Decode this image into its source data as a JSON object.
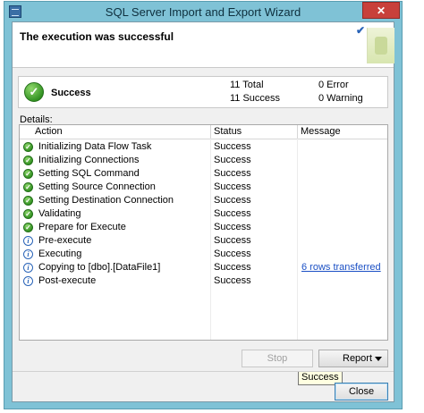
{
  "window": {
    "title": "SQL Server Import and Export Wizard",
    "close_glyph": "✕",
    "accent_color": "#7fc2d6"
  },
  "header": {
    "title": "The execution was successful",
    "check_glyph": "✔"
  },
  "summary": {
    "status_label": "Success",
    "total": "11 Total",
    "success": "11 Success",
    "error": "0  Error",
    "warning": "0  Warning"
  },
  "details": {
    "label": "Details:",
    "columns": [
      "Action",
      "Status",
      "Message"
    ],
    "rows": [
      {
        "icon": "success-check-icon",
        "action": "Initializing Data Flow Task",
        "status": "Success",
        "message": ""
      },
      {
        "icon": "success-check-icon",
        "action": "Initializing Connections",
        "status": "Success",
        "message": ""
      },
      {
        "icon": "success-check-icon",
        "action": "Setting SQL Command",
        "status": "Success",
        "message": ""
      },
      {
        "icon": "success-check-icon",
        "action": "Setting Source Connection",
        "status": "Success",
        "message": ""
      },
      {
        "icon": "success-check-icon",
        "action": "Setting Destination Connection",
        "status": "Success",
        "message": ""
      },
      {
        "icon": "success-check-icon",
        "action": "Validating",
        "status": "Success",
        "message": ""
      },
      {
        "icon": "success-check-icon",
        "action": "Prepare for Execute",
        "status": "Success",
        "message": ""
      },
      {
        "icon": "info-icon",
        "action": "Pre-execute",
        "status": "Success",
        "message": ""
      },
      {
        "icon": "info-icon",
        "action": "Executing",
        "status": "Success",
        "message": ""
      },
      {
        "icon": "info-icon",
        "action": "Copying to [dbo].[DataFile1]",
        "status": "Success",
        "message": "6 rows transferred"
      },
      {
        "icon": "info-icon",
        "action": "Post-execute",
        "status": "Success",
        "message": ""
      }
    ],
    "tooltip": "Success"
  },
  "buttons": {
    "stop": "Stop",
    "report": "Report",
    "close": "Close"
  }
}
